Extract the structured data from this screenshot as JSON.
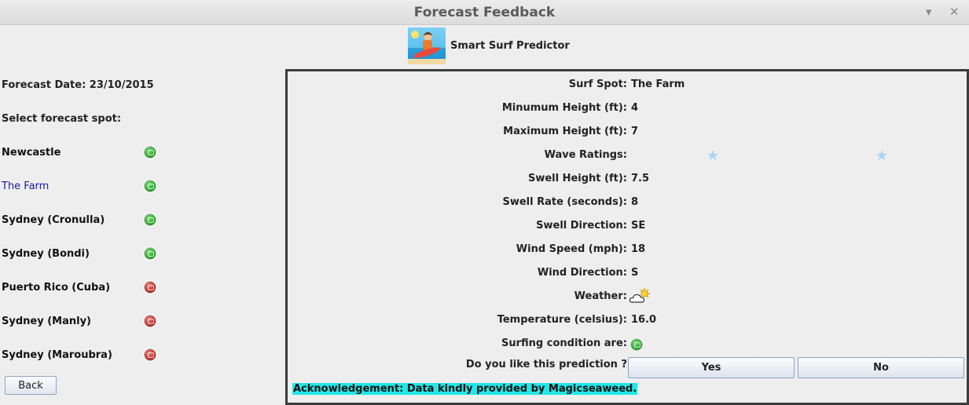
{
  "window": {
    "title": "Forecast Feedback",
    "minimize_icon": "chevron-down-icon",
    "close_icon": "close-icon"
  },
  "header": {
    "app_name": "Smart Surf Predictor",
    "logo_icon": "surfer-logo-icon"
  },
  "sidebar": {
    "forecast_date_label": "Forecast Date: 23/10/2015",
    "select_label": "Select forecast spot:",
    "spots": [
      {
        "name": "Newcastle",
        "status": "good"
      },
      {
        "name": "The Farm",
        "status": "good",
        "selected": true
      },
      {
        "name": "Sydney (Cronulla)",
        "status": "good"
      },
      {
        "name": "Sydney (Bondi)",
        "status": "good"
      },
      {
        "name": "Puerto Rico (Cuba)",
        "status": "bad"
      },
      {
        "name": "Sydney (Manly)",
        "status": "bad"
      },
      {
        "name": "Sydney (Maroubra)",
        "status": "bad"
      }
    ],
    "back_label": "Back"
  },
  "details": {
    "rows": [
      {
        "label": "Surf Spot:",
        "value": "The Farm"
      },
      {
        "label": "Minumum Height (ft):",
        "value": "4"
      },
      {
        "label": "Maximum Height (ft):",
        "value": "7"
      },
      {
        "label": "Wave Ratings:",
        "value": ""
      },
      {
        "label": "Swell Height (ft):",
        "value": "7.5"
      },
      {
        "label": "Swell Rate (seconds):",
        "value": "8"
      },
      {
        "label": "Swell Direction:",
        "value": "SE"
      },
      {
        "label": "Wind Speed (mph):",
        "value": "18"
      },
      {
        "label": "Wind Direction:",
        "value": "S"
      },
      {
        "label": "Weather:",
        "value": ""
      },
      {
        "label": "Temperature (celsius):",
        "value": "16.0"
      },
      {
        "label": "Surfing condition are:",
        "value": ""
      }
    ],
    "wave_rating_stars": 2,
    "weather_icon": "partly-cloudy-icon",
    "condition_status": "good",
    "prompt": "Do you like this prediction ?",
    "yes_label": "Yes",
    "no_label": "No",
    "acknowledgement": "Acknowledgement: Data kindly provided by Magicseaweed."
  },
  "colors": {
    "selected_spot": "#1a1aa8",
    "good": "#1f9a1f",
    "bad": "#b01f1f",
    "acknowledgement_bg": "#22e6e6",
    "star": "#a9d3f5"
  }
}
